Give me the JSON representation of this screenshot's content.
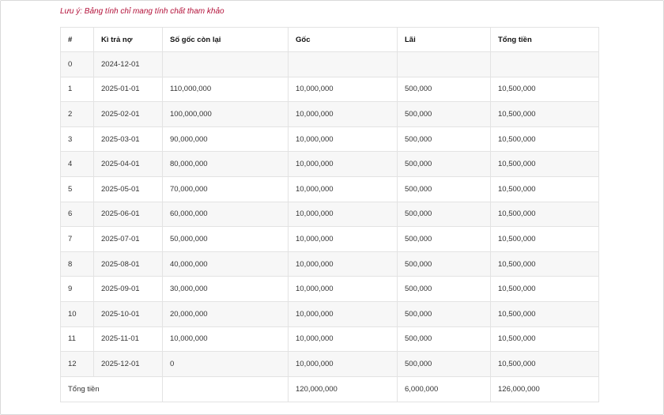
{
  "note": "Lưu ý: Bảng tính chỉ mang tính chất tham khảo",
  "table": {
    "headers": [
      "#",
      "Kì trả nợ",
      "Số gốc còn lại",
      "Gốc",
      "Lãi",
      "Tổng tiền"
    ],
    "rows": [
      [
        "0",
        "2024-12-01",
        "",
        "",
        "",
        ""
      ],
      [
        "1",
        "2025-01-01",
        "110,000,000",
        "10,000,000",
        "500,000",
        "10,500,000"
      ],
      [
        "2",
        "2025-02-01",
        "100,000,000",
        "10,000,000",
        "500,000",
        "10,500,000"
      ],
      [
        "3",
        "2025-03-01",
        "90,000,000",
        "10,000,000",
        "500,000",
        "10,500,000"
      ],
      [
        "4",
        "2025-04-01",
        "80,000,000",
        "10,000,000",
        "500,000",
        "10,500,000"
      ],
      [
        "5",
        "2025-05-01",
        "70,000,000",
        "10,000,000",
        "500,000",
        "10,500,000"
      ],
      [
        "6",
        "2025-06-01",
        "60,000,000",
        "10,000,000",
        "500,000",
        "10,500,000"
      ],
      [
        "7",
        "2025-07-01",
        "50,000,000",
        "10,000,000",
        "500,000",
        "10,500,000"
      ],
      [
        "8",
        "2025-08-01",
        "40,000,000",
        "10,000,000",
        "500,000",
        "10,500,000"
      ],
      [
        "9",
        "2025-09-01",
        "30,000,000",
        "10,000,000",
        "500,000",
        "10,500,000"
      ],
      [
        "10",
        "2025-10-01",
        "20,000,000",
        "10,000,000",
        "500,000",
        "10,500,000"
      ],
      [
        "11",
        "2025-11-01",
        "10,000,000",
        "10,000,000",
        "500,000",
        "10,500,000"
      ],
      [
        "12",
        "2025-12-01",
        "0",
        "10,000,000",
        "500,000",
        "10,500,000"
      ]
    ],
    "footer": {
      "label": "Tổng tiền",
      "principal_total": "120,000,000",
      "interest_total": "6,000,000",
      "grand_total": "126,000,000"
    }
  }
}
